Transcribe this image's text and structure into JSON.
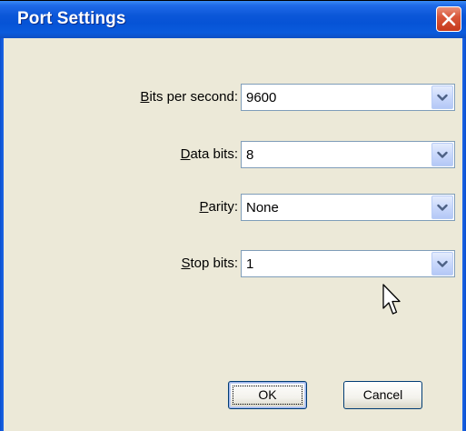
{
  "window": {
    "title": "Port Settings",
    "close_icon": "close-icon",
    "accent_color": "#0653d6",
    "close_color": "#c63a1c",
    "client_color": "#ece9d8"
  },
  "fields": [
    {
      "label_accel": "B",
      "label_rest": "its per second:",
      "value": "9600"
    },
    {
      "label_accel": "D",
      "label_rest": "ata bits:",
      "value": "8"
    },
    {
      "label_accel": "P",
      "label_rest": "arity:",
      "value": "None"
    },
    {
      "label_accel": "S",
      "label_rest": "top bits:",
      "value": "1"
    }
  ],
  "buttons": {
    "ok_label": "OK",
    "cancel_label": "Cancel"
  },
  "icons": {
    "dropdown": "chevron-down-icon",
    "pointer": "mouse-pointer-icon"
  }
}
